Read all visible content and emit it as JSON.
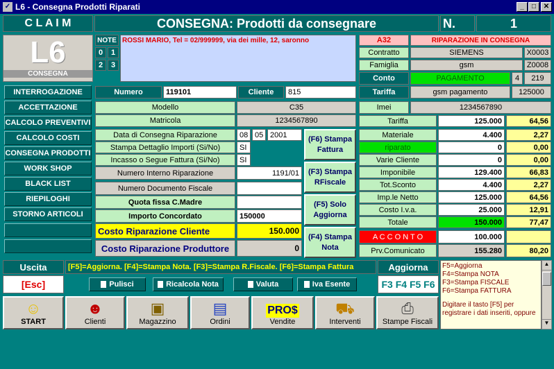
{
  "window": {
    "title": "L6 - Consegna Prodotti Riparati",
    "app_icon": "app-icon"
  },
  "header": {
    "claim": "C L A I M",
    "title": "CONSEGNA:  Prodotti da consegnare",
    "n_label": "N.",
    "n_value": "1"
  },
  "logo": {
    "big": "L6",
    "sub": "CONSEGNA"
  },
  "note": {
    "label": "NOTE",
    "b0": "0",
    "b1": "1",
    "b2": "2",
    "b3": "3",
    "text": "ROSSI MARIO, Tel = 02/999999, via dei mille, 12, saronno"
  },
  "sidebar": {
    "items": [
      "INTERROGAZIONE",
      "ACCETTAZIONE",
      "CALCOLO PREVENTIVI",
      "CALCOLO COSTI",
      "CONSEGNA PRODOTTI",
      "WORK SHOP",
      "BLACK LIST",
      "RIEPILOGHI",
      "STORNO ARTICOLI"
    ]
  },
  "info": {
    "code": "A32",
    "status": "RIPARAZIONE IN CONSEGNA",
    "contratto_label": "Contratto",
    "contratto": "SIEMENS",
    "contratto_code": "X0003",
    "famiglia_label": "Famiglia",
    "famiglia": "gsm",
    "famiglia_code": "Z0008",
    "conto_label": "Conto",
    "conto": "PAGAMENTO",
    "conto_n1": "4",
    "conto_n2": "219",
    "tariffa_label": "Tariffa",
    "tariffa": "gsm pagamento",
    "tariffa_val": "125000",
    "imei_label": "Imei",
    "imei": "1234567890"
  },
  "form": {
    "numero_label": "Numero",
    "numero": "119101",
    "cliente_label": "Cliente",
    "cliente": "815",
    "modello_label": "Modello",
    "modello": "C35",
    "matricola_label": "Matricola",
    "matricola": "1234567890",
    "data_label": "Data di Consegna Riparazione",
    "day": "08",
    "month": "05",
    "year": "2001",
    "stampa_label": "Stampa Dettaglio Importi (Si/No)",
    "stampa": "SI",
    "incasso_label": "Incasso o Segue Fattura (Si/No)",
    "incasso": "SI",
    "nir_label": "Numero Interno Riparazione",
    "nir": "1191/01",
    "ndf_label": "Numero Documento Fiscale",
    "ndf": "",
    "quota_label": "Quota fissa C.Madre",
    "quota": "",
    "importo_label": "Importo Concordato",
    "importo": "150000",
    "costo_cli_label": "Costo Riparazione Cliente",
    "costo_cli": "150.000",
    "costo_prod_label": "Costo Riparazione Produttore",
    "costo_prod": "0"
  },
  "actions": {
    "f6": "(F6) Stampa Fattura",
    "f3": "(F3) Stampa RFiscale",
    "f5": "(F5) Solo Aggiorna",
    "f4": "(F4) Stampa Nota"
  },
  "totals": [
    {
      "label": "Tariffa",
      "v1": "125.000",
      "v2": "64,56"
    },
    {
      "label": "Materiale",
      "v1": "4.400",
      "v2": "2,27"
    },
    {
      "label": "riparato",
      "v1": "0",
      "v2": "0,00"
    },
    {
      "label": "Varie Cliente",
      "v1": "0",
      "v2": "0,00"
    },
    {
      "label": "Imponibile",
      "v1": "129.400",
      "v2": "66,83"
    },
    {
      "label": "Tot.Sconto",
      "v1": "4.400",
      "v2": "2,27"
    },
    {
      "label": "Imp.le Netto",
      "v1": "125.000",
      "v2": "64,56"
    },
    {
      "label": "Costo I.v.a.",
      "v1": "25.000",
      "v2": "12,91"
    },
    {
      "label": "Totale",
      "v1": "150.000",
      "v2": "77,47"
    },
    {
      "label": "A C C O N T O",
      "v1": "100.000",
      "v2": ""
    },
    {
      "label": "Prv.Comunicato",
      "v1": "155.280",
      "v2": "80,20"
    }
  ],
  "bottom": {
    "uscita": "Uscita",
    "esc": "[Esc]",
    "hint": "[F5]=Aggiorna. [F4]=Stampa Nota. [F3]=Stampa R.Fiscale. [F6]=Stampa Fattura",
    "aggiorna": "Aggiorna",
    "fkeys": "F3 F4 F5 F6",
    "pulisci": "Pulisci",
    "ricalcola": "Ricalcola Nota",
    "valuta": "Valuta",
    "iva": "Iva Esente",
    "help1": "F5=Aggiorna",
    "help2": "F4=Stampa NOTA",
    "help3": "F3=Stampa FISCALE",
    "help4": "F6=Stampa FATTURA",
    "help5": "Digitare il tasto [F5] per registrare i dati inseriti, oppure"
  },
  "toolbar": [
    "START",
    "Clienti",
    "Magazzino",
    "Ordini",
    "Vendite",
    "Interventi",
    "Stampe Fiscali"
  ],
  "colors": {
    "teal": "#008080",
    "dark_teal": "#006666",
    "light_green": "#c0f0c0",
    "green": "#00e000",
    "red": "#ff0000",
    "yellow": "#ffff99"
  }
}
